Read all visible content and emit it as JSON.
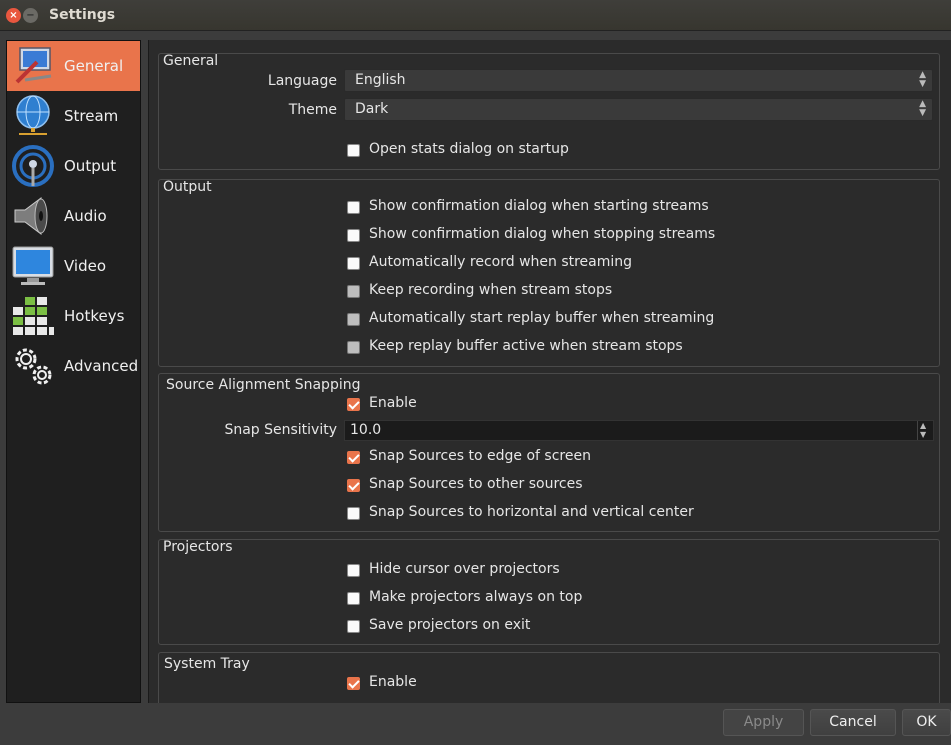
{
  "window": {
    "title": "Settings",
    "close_glyph": "×",
    "min_glyph": "−"
  },
  "sidebar": {
    "items": [
      {
        "label": "General",
        "icon": "general-icon",
        "selected": true
      },
      {
        "label": "Stream",
        "icon": "globe-icon"
      },
      {
        "label": "Output",
        "icon": "antenna-icon"
      },
      {
        "label": "Audio",
        "icon": "speaker-icon"
      },
      {
        "label": "Video",
        "icon": "monitor-icon"
      },
      {
        "label": "Hotkeys",
        "icon": "keyboard-icon"
      },
      {
        "label": "Advanced",
        "icon": "gears-icon"
      }
    ]
  },
  "general": {
    "title": "General",
    "language_label": "Language",
    "language_value": "English",
    "theme_label": "Theme",
    "theme_value": "Dark",
    "open_stats": "Open stats dialog on startup"
  },
  "output": {
    "title": "Output",
    "items": [
      "Show confirmation dialog when starting streams",
      "Show confirmation dialog when stopping streams",
      "Automatically record when streaming",
      "Keep recording when stream stops",
      "Automatically start replay buffer when streaming",
      "Keep replay buffer active when stream stops"
    ]
  },
  "snapping": {
    "title": "Source Alignment Snapping",
    "enable": "Enable",
    "sensitivity_label": "Snap Sensitivity",
    "sensitivity_value": "10.0",
    "items": [
      "Snap Sources to edge of screen",
      "Snap Sources to other sources",
      "Snap Sources to horizontal and vertical center"
    ]
  },
  "projectors": {
    "title": "Projectors",
    "items": [
      "Hide cursor over projectors",
      "Make projectors always on top",
      "Save projectors on exit"
    ]
  },
  "tray": {
    "title": "System Tray",
    "enable": "Enable"
  },
  "buttons": {
    "apply": "Apply",
    "cancel": "Cancel",
    "ok": "OK"
  },
  "colors": {
    "accent": "#e9744b",
    "panel": "#2b2b2b",
    "sidebar": "#1f1f1f",
    "window": "#3c3c3c"
  }
}
